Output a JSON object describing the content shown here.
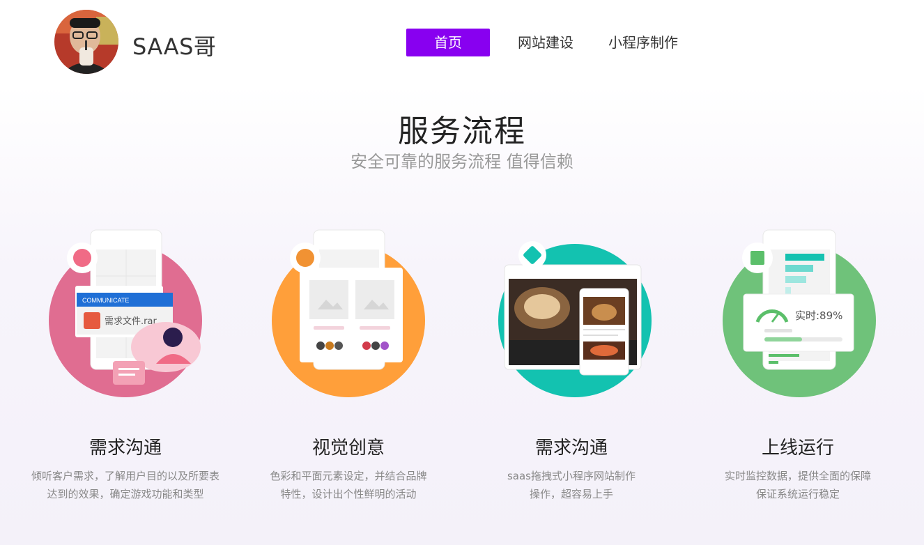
{
  "header": {
    "brand": "SAAS哥",
    "nav": [
      {
        "label": "首页",
        "active": true
      },
      {
        "label": "网站建设",
        "active": false
      },
      {
        "label": "小程序制作",
        "active": false
      }
    ]
  },
  "section": {
    "title": "服务流程",
    "subtitle": "安全可靠的服务流程 值得信赖"
  },
  "steps": [
    {
      "title": "需求沟通",
      "desc_line1": "倾听客户需求，了解用户目的以及所要表",
      "desc_line2": "达到的效果，确定游戏功能和类型",
      "card_label": "COMMUNICATE",
      "file_name": "需求文件.rar",
      "circle_color": "#e06d91"
    },
    {
      "title": "视觉创意",
      "desc_line1": "色彩和平面元素设定，并结合品牌",
      "desc_line2": "特性，设计出个性鲜明的活动",
      "circle_color": "#ff9f3a"
    },
    {
      "title": "需求沟通",
      "desc_line1": "saas拖拽式小程序网站制作",
      "desc_line2": "操作，超容易上手",
      "circle_color": "#13c2b0"
    },
    {
      "title": "上线运行",
      "desc_line1": "实时监控数据，提供全面的保障",
      "desc_line2": "保证系统运行稳定",
      "gauge_text": "实时:89%",
      "circle_color": "#6fc27a"
    }
  ]
}
